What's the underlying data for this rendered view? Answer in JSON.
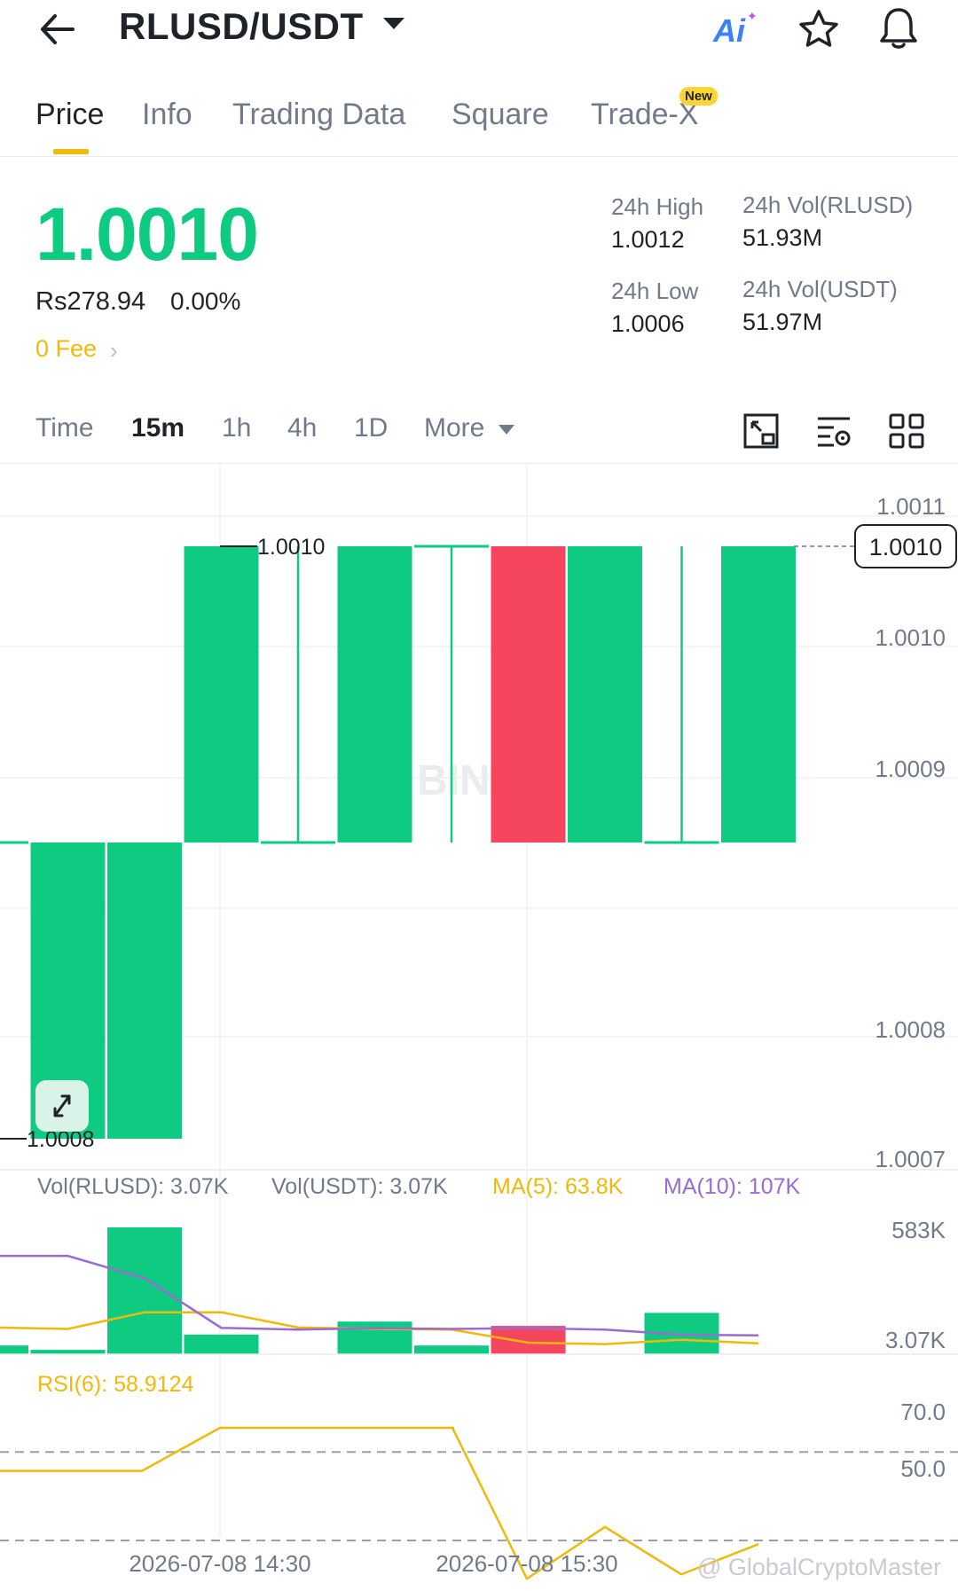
{
  "header": {
    "pair": "RLUSD/USDT",
    "ai_label": "Ai",
    "icons": [
      "back-arrow-icon",
      "caret-down-icon",
      "ai-icon",
      "star-icon",
      "bell-icon"
    ]
  },
  "tabs": [
    {
      "label": "Price",
      "active": true
    },
    {
      "label": "Info"
    },
    {
      "label": "Trading Data"
    },
    {
      "label": "Square"
    },
    {
      "label": "Trade-X",
      "badge": "New"
    }
  ],
  "price": {
    "last": "1.0010",
    "fiat": "Rs278.94",
    "change": "0.00%",
    "fee": "0 Fee",
    "color_up": "#0ecb81",
    "color_down": "#f6465d",
    "accent": "#f0b90b"
  },
  "stats": {
    "high_label": "24h High",
    "high": "1.0012",
    "low_label": "24h Low",
    "low": "1.0006",
    "vol_base_label": "24h Vol(RLUSD)",
    "vol_base": "51.93M",
    "vol_quote_label": "24h Vol(USDT)",
    "vol_quote": "51.97M"
  },
  "intervals": {
    "items": [
      "Time",
      "15m",
      "1h",
      "4h",
      "1D",
      "More"
    ],
    "active": "15m"
  },
  "chart_data": {
    "type": "candlestick",
    "price_axis": [
      "1.0011",
      "1.0010",
      "1.0009",
      "1.0008",
      "1.0007"
    ],
    "current_price_label": "1.0010",
    "max_label": "1.0010",
    "min_label": "1.0008",
    "watermark_text": "BIN",
    "candles": [
      {
        "open": 1.00087,
        "close": 1.00087,
        "high": 1.00087,
        "low": 1.00087
      },
      {
        "open": 1.00078,
        "close": 1.00087,
        "high": 1.00087,
        "low": 1.00078
      },
      {
        "open": 1.00078,
        "close": 1.00087,
        "high": 1.00087,
        "low": 1.00078
      },
      {
        "open": 1.00087,
        "close": 1.000993,
        "high": 1.000993,
        "low": 1.00087
      },
      {
        "open": 1.00087,
        "close": 1.00087,
        "high": 1.000993,
        "low": 1.00087
      },
      {
        "open": 1.00087,
        "close": 1.000993,
        "high": 1.000993,
        "low": 1.00087
      },
      {
        "open": 1.000993,
        "close": 1.000993,
        "high": 1.000993,
        "low": 1.00087
      },
      {
        "open": 1.000993,
        "close": 1.00087,
        "high": 1.000993,
        "low": 1.00087
      },
      {
        "open": 1.00087,
        "close": 1.000993,
        "high": 1.000993,
        "low": 1.00087
      },
      {
        "open": 1.00087,
        "close": 1.00087,
        "high": 1.000993,
        "low": 1.00087
      },
      {
        "open": 1.00087,
        "close": 1.000993,
        "high": 1.000993,
        "low": 1.00087
      }
    ],
    "volume": {
      "legend": {
        "vol_base": "Vol(RLUSD): 3.07K",
        "vol_quote": "Vol(USDT): 3.07K",
        "ma5": "MA(5): 63.8K",
        "ma10": "MA(10): 107K"
      },
      "axis": [
        "583K",
        "3.07K"
      ],
      "bars_k": [
        40,
        20,
        583,
        90,
        0,
        150,
        40,
        130,
        0,
        190,
        0
      ],
      "ma5_k": [
        185,
        175,
        290,
        290,
        185,
        175,
        170,
        80,
        70,
        100,
        75
      ],
      "ma10_k": [
        680,
        680,
        525,
        182,
        170,
        180,
        175,
        180,
        170,
        135,
        130
      ],
      "ma5_color": "#f0b90b",
      "ma10_color": "#9b6bd1"
    },
    "rsi": {
      "label": "RSI(6): 58.9124",
      "axis": [
        "70.0",
        "50.0"
      ],
      "values": [
        65,
        65,
        65,
        75,
        75,
        75,
        75,
        75,
        75,
        75,
        40,
        52,
        41,
        48
      ],
      "x_index": [
        0,
        1,
        2,
        3,
        4,
        5,
        6,
        7,
        8,
        9,
        10,
        11,
        12,
        13
      ],
      "color": "#f0b90b"
    },
    "time_axis": [
      "2026-07-08 14:30",
      "2026-07-08 15:30"
    ]
  },
  "watermark": "@ GlobalCryptoMaster"
}
